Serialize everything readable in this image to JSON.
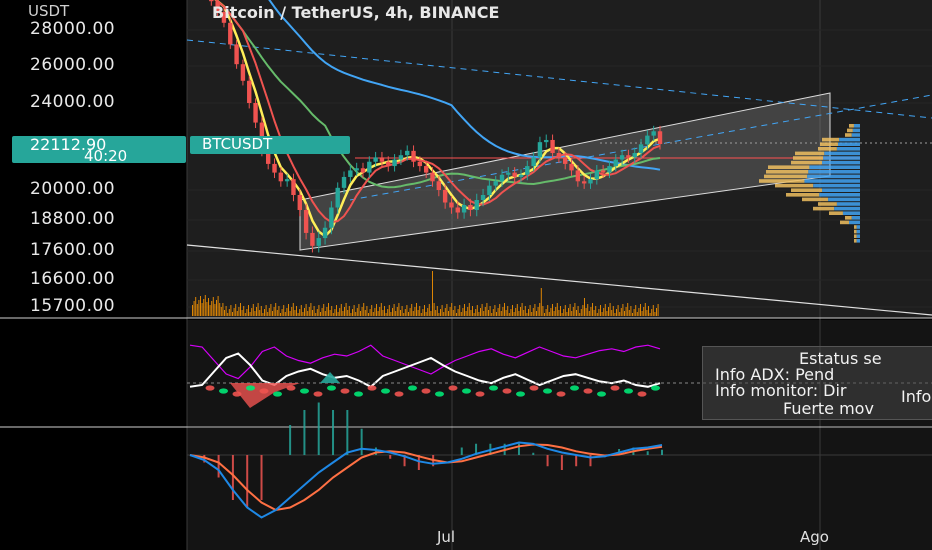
{
  "chart_title": "Bitcoin / TetherUS, 4h, BINANCE",
  "axis_unit": "USDT",
  "price_ticks": [
    "28000.00",
    "26000.00",
    "24000.00",
    "20000.00",
    "18800.00",
    "17600.00",
    "16600.00",
    "15700.00"
  ],
  "current_price": {
    "price": "22112.90",
    "countdown": "40:20",
    "symbol": "BTCUSDT"
  },
  "x_ticks": [
    "Jul",
    "Ago"
  ],
  "info_panel": [
    "Estatus se",
    "Info ADX: Pend",
    "Info monitor: Dir",
    "Info",
    "Fuerte mov"
  ],
  "colors": {
    "up": "#26a69a",
    "down": "#ef5350",
    "ma_blue": "#42a5f5",
    "ma_green": "#66bb6a",
    "ma_yellow": "#ffee58",
    "ma_red": "#ef5350",
    "volume": "#ff9800",
    "rsi": "#d500f9",
    "macd": "#1e88e5",
    "signal": "#ff7043"
  },
  "chart_data": [
    {
      "type": "candlestick",
      "title": "Bitcoin / TetherUS, 4h, BINANCE",
      "ylabel": "USDT",
      "ylim": [
        15700,
        28000
      ],
      "x_tick_labels": [
        "Jul",
        "Ago"
      ],
      "series": [
        {
          "name": "BTCUSDT",
          "values": [
            30200,
            29600,
            29000,
            28400,
            27200,
            26100,
            25200,
            24000,
            23100,
            21800,
            21200,
            20800,
            20400,
            20500,
            19800,
            19200,
            18300,
            17800,
            18100,
            18500,
            19300,
            20100,
            20600,
            20900,
            21000,
            20800,
            21300,
            21500,
            21300,
            21100,
            21400,
            21600,
            21800,
            21300,
            21100,
            20800,
            20400,
            20000,
            19500,
            19300,
            19100,
            19400,
            19200,
            19600,
            19800,
            20200,
            20400,
            20700,
            20800,
            20600,
            20700,
            21100,
            21500,
            22200,
            22300,
            21700,
            21500,
            21200,
            20900,
            20400,
            20300,
            20500,
            20900,
            20800,
            21100,
            21400,
            21600,
            21500,
            21700,
            22100,
            22500,
            22700,
            22113
          ]
        }
      ],
      "volume_profile_center": 22112.9,
      "resistance": 21700
    },
    {
      "type": "line",
      "title": "",
      "series": [
        {
          "name": "",
          "values": [
            62,
            60,
            45,
            30,
            25,
            38,
            55,
            60,
            50,
            45,
            42,
            48,
            52,
            50,
            55,
            62,
            50,
            45,
            40,
            35,
            30,
            38,
            45,
            50,
            55,
            58,
            52,
            48,
            54,
            60,
            55,
            50,
            48,
            52,
            56,
            58,
            55,
            60,
            62,
            58
          ]
        }
      ]
    },
    {
      "type": "line",
      "title": "",
      "series": [
        {
          "name": "",
          "values": [
            0,
            -200,
            -600,
            -1400,
            -2100,
            -2500,
            -2200,
            -1700,
            -1200,
            -700,
            -300,
            100,
            250,
            200,
            100,
            -50,
            -250,
            -350,
            -300,
            -150,
            50,
            200,
            350,
            500,
            450,
            250,
            100,
            0,
            -100,
            -50,
            100,
            250,
            300,
            400
          ]
        },
        {
          "name": "",
          "values": [
            0,
            -100,
            -300,
            -800,
            -1400,
            -1900,
            -2200,
            -2100,
            -1800,
            -1400,
            -900,
            -500,
            -100,
            100,
            150,
            100,
            -50,
            -200,
            -300,
            -250,
            -100,
            50,
            200,
            350,
            420,
            400,
            300,
            150,
            50,
            -20,
            20,
            150,
            250,
            330
          ]
        }
      ]
    }
  ]
}
